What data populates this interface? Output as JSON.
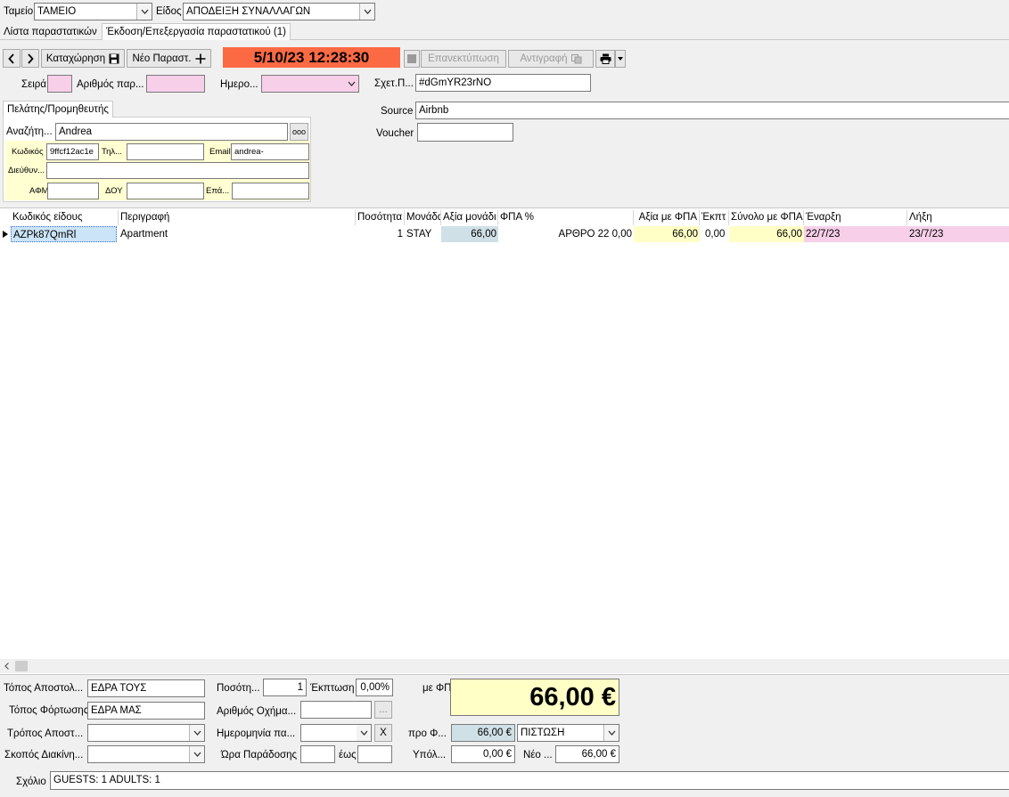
{
  "top": {
    "cashier_label": "Ταμείο",
    "cashier_value": "ΤΑΜΕΙΟ",
    "type_label": "Είδος",
    "type_value": "ΑΠΟΔΕΙΞΗ ΣΥΝΑΛΛΑΓΩΝ"
  },
  "tabs": {
    "list": "Λίστα παραστατικών",
    "edit": "Έκδοση/Επεξεργασία παραστατικού (1)"
  },
  "toolbar": {
    "save": "Καταχώρηση",
    "new_doc": "Νέο Παραστ.",
    "datetime": "5/10/23 12:28:30",
    "reprint": "Επανεκτύπωση",
    "copy": "Αντιγραφή"
  },
  "header": {
    "series_label": "Σειρά",
    "number_label": "Αριθμός παρ...",
    "date_label": "Ημερο...",
    "related_label": "Σχετ.Π...",
    "related_value": "#dGmYR23rNO",
    "source_label": "Source",
    "source_value": "Airbnb",
    "voucher_label": "Voucher"
  },
  "client": {
    "tab": "Πελάτης/Προμηθευτής",
    "search_label": "Αναζήτη...",
    "search_value": "Andrea",
    "more": "ooo",
    "code_label": "Κωδικός",
    "code_value": "9ffcf12ac1e",
    "phone_label": "Τηλ...",
    "email_label": "Email",
    "email_value": "andrea-",
    "address_label": "Διεύθυν...",
    "afm_label": "ΑΦΜ",
    "doy_label": "ΔΟΥ",
    "prof_label": "Επά..."
  },
  "grid": {
    "headers": [
      "Κωδικός είδους",
      "Περιγραφή",
      "Ποσότητα",
      "Μονάδα",
      "Αξία μονάδι",
      "ΦΠΑ %",
      "Αξία με ΦΠΑ",
      "Έκπτ",
      "Σύνολο με ΦΠΑ",
      "Έναρξη",
      "Λήξη"
    ],
    "rows": [
      {
        "code": "AZPk87QmRl",
        "desc": "Apartment",
        "qty": "1",
        "unit": "STAY",
        "unit_value": "66,00",
        "vat": "ΑΡΘΡΟ 22 0,00",
        "value_vat": "66,00",
        "discount": "0,00",
        "total": "66,00",
        "start": "22/7/23",
        "end": "23/7/23"
      }
    ]
  },
  "footer": {
    "dispatch_place_label": "Τόπος Αποστολ...",
    "dispatch_place_value": "ΕΔΡΑ ΤΟΥΣ",
    "loading_place_label": "Τόπος Φόρτωσης",
    "loading_place_value": "ΕΔΡΑ ΜΑΣ",
    "dispatch_mode_label": "Τρόπος Αποστ...",
    "purpose_label": "Σκοπός Διακίνη...",
    "qty_label": "Ποσότη...",
    "qty_value": "1",
    "discount_label": "Έκπτωση",
    "discount_value": "0,00%",
    "vehicle_label": "Αριθμός Οχήμα...",
    "vehicle_btn": "...",
    "date_label": "Ημερομηνία πα...",
    "clear_btn": "X",
    "delivery_time_label": "Ώρα Παράδοσης",
    "until_label": "έως",
    "with_vat_label": "με ΦΠΑ",
    "with_vat_value": "66,00 €",
    "pre_label": "προ Φ...",
    "pre_value": "66,00 €",
    "payment_value": "ΠΙΣΤΩΣΗ",
    "balance_label": "Υπόλ...",
    "balance_value": "0,00 €",
    "new_label": "Νέο ...",
    "new_value": "66,00 €",
    "comment_label": "Σχόλιο",
    "comment_value": "GUESTS: 1 ADULTS: 1"
  },
  "colors": {
    "datetime_bg": "#fc6a44",
    "pink": "#f7cfe9",
    "blue": "#cfe0e6",
    "yellow": "#ffffc6"
  }
}
